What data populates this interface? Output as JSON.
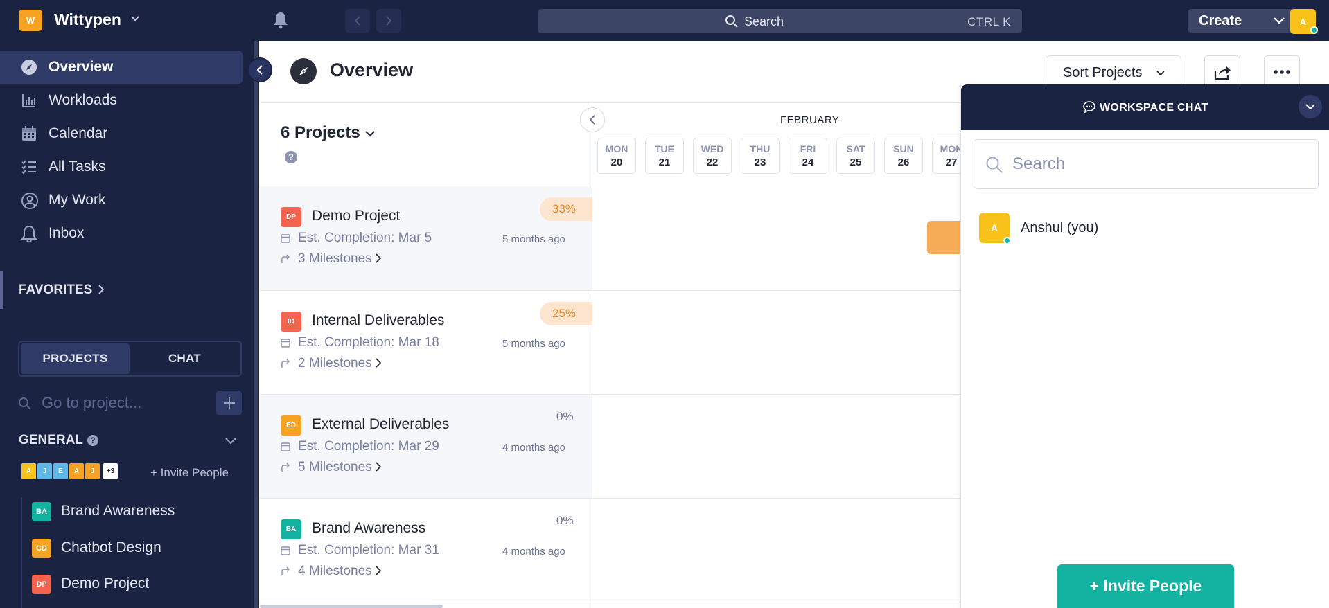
{
  "topbar": {
    "workspace_initial": "W",
    "workspace_name": "Wittypen",
    "search_label": "Search",
    "search_shortcut": "CTRL K",
    "create_label": "Create",
    "user_initial": "A"
  },
  "sidebar": {
    "nav": [
      {
        "label": "Overview",
        "icon": "compass-icon",
        "active": true
      },
      {
        "label": "Workloads",
        "icon": "bar-chart-icon"
      },
      {
        "label": "Calendar",
        "icon": "calendar-icon"
      },
      {
        "label": "All Tasks",
        "icon": "task-list-icon"
      },
      {
        "label": "My Work",
        "icon": "user-check-icon"
      },
      {
        "label": "Inbox",
        "icon": "bell-icon"
      }
    ],
    "favorites_label": "FAVORITES",
    "tabs": {
      "projects": "PROJECTS",
      "chat": "CHAT"
    },
    "goto_placeholder": "Go to project...",
    "general_label": "GENERAL",
    "general_help": "?",
    "members": [
      {
        "initial": "A",
        "color": "#f8c21b"
      },
      {
        "initial": "J",
        "color": "#5fb8e8"
      },
      {
        "initial": "E",
        "color": "#5fb8e8"
      },
      {
        "initial": "A",
        "color": "#f6a223"
      },
      {
        "initial": "J",
        "color": "#f6a223"
      },
      {
        "initial": "+3",
        "color": "#ffffff"
      }
    ],
    "invite_label": "+ Invite People",
    "projects": [
      {
        "badge": "BA",
        "label": "Brand Awareness",
        "color": "#14b2a0"
      },
      {
        "badge": "CD",
        "label": "Chatbot Design",
        "color": "#f6a223"
      },
      {
        "badge": "DP",
        "label": "Demo Project",
        "color": "#f4634f"
      }
    ]
  },
  "header": {
    "title": "Overview",
    "sort_label": "Sort Projects"
  },
  "projects_list": {
    "count_label": "6 Projects",
    "help": "?",
    "rows": [
      {
        "badge": "DP",
        "color": "#f4634f",
        "name": "Demo Project",
        "est": "Est. Completion: Mar 5",
        "milestones": "3 Milestones",
        "ago": "5 months ago",
        "progress": "33%"
      },
      {
        "badge": "ID",
        "color": "#f4634f",
        "name": "Internal Deliverables",
        "est": "Est. Completion: Mar 18",
        "milestones": "2 Milestones",
        "ago": "5 months ago",
        "progress": "25%"
      },
      {
        "badge": "ED",
        "color": "#f6a223",
        "name": "External Deliverables",
        "est": "Est. Completion: Mar 29",
        "milestones": "5 Milestones",
        "ago": "4 months ago",
        "progress": "0%"
      },
      {
        "badge": "BA",
        "color": "#14b2a0",
        "name": "Brand Awareness",
        "est": "Est. Completion: Mar 31",
        "milestones": "4 Milestones",
        "ago": "4 months ago",
        "progress": "0%"
      }
    ]
  },
  "timeline": {
    "month": "FEBRUARY",
    "days": [
      {
        "name": "MON",
        "date": "20"
      },
      {
        "name": "TUE",
        "date": "21"
      },
      {
        "name": "WED",
        "date": "22"
      },
      {
        "name": "THU",
        "date": "23"
      },
      {
        "name": "FRI",
        "date": "24"
      },
      {
        "name": "SAT",
        "date": "25"
      },
      {
        "name": "SUN",
        "date": "26"
      },
      {
        "name": "MON",
        "date": "27"
      }
    ]
  },
  "chat_panel": {
    "title": "WORKSPACE CHAT",
    "search_placeholder": "Search",
    "users": [
      {
        "initial": "A",
        "name": "Anshul (you)",
        "online": true
      }
    ],
    "invite_label": "+ Invite People"
  },
  "colors": {
    "navy": "#1b2342",
    "accent_teal": "#14b2a0",
    "accent_orange": "#f6a223"
  }
}
